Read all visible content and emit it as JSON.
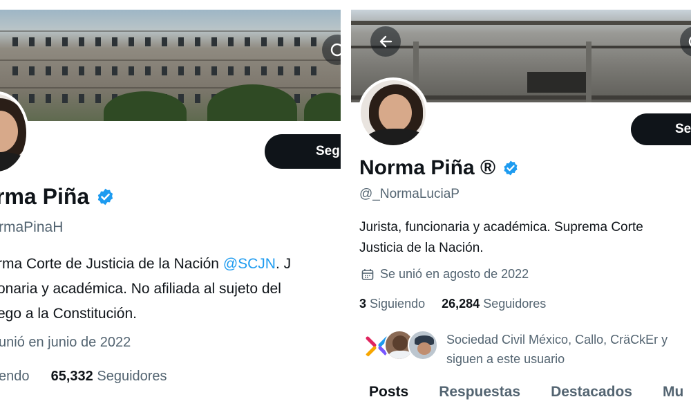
{
  "left": {
    "name": "rma Piña",
    "handle": "rmaPinaH",
    "bio_lines": [
      {
        "text": "rma Corte de Justicia de la Nación ",
        "mention": "@SCJN",
        "after": ". J"
      },
      {
        "text": "onaria y académica. No afiliada al sujeto del",
        "mention": "",
        "after": ""
      },
      {
        "text": "ego a la Constitución.",
        "mention": "",
        "after": ""
      }
    ],
    "joined": "unió en junio de 2022",
    "following_label": "endo",
    "followers_count": "65,332",
    "followers_label": "Seguidores",
    "follow_button": "Seg",
    "icons": {
      "verified": "verified-badge-icon",
      "more": "more-options-icon"
    }
  },
  "right": {
    "name": "Norma Piña ®",
    "handle": "@_NormaLuciaP",
    "bio_lines": [
      "Jurista, funcionaria y académica. Suprema Corte",
      "Justicia de la Nación."
    ],
    "joined": "Se unió en agosto de 2022",
    "following_count": "3",
    "following_label": "Siguiendo",
    "followers_count": "26,284",
    "followers_label": "Seguidores",
    "followed_by_lines": [
      "Sociedad Civil México, Callo, CräCkEr y",
      "siguen a este usuario"
    ],
    "follow_button": "Se",
    "tabs": [
      "Posts",
      "Respuestas",
      "Destacados",
      "Mu"
    ],
    "active_tab": "Posts",
    "icons": {
      "back": "back-arrow-icon",
      "calendar": "calendar-icon",
      "verified": "verified-badge-icon"
    }
  },
  "colors": {
    "accent": "#1d9bf0",
    "text": "#0f1419",
    "muted": "#536471"
  }
}
